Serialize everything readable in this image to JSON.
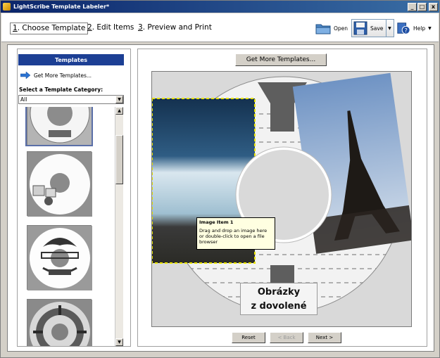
{
  "window": {
    "title": "LightScribe Template Labeler*",
    "min": "_",
    "max": "□",
    "close": "x"
  },
  "steps": [
    {
      "num": "1",
      "label": ". Choose Template"
    },
    {
      "num": "2",
      "label": ". Edit Items"
    },
    {
      "num": "3",
      "label": ". Preview and Print"
    }
  ],
  "toolbar": {
    "open": "Open",
    "save": "Save",
    "help": "Help"
  },
  "left": {
    "header": "Templates",
    "get_more": "Get More Templates...",
    "category_label": "Select a Template Category:",
    "category_value": "All"
  },
  "right": {
    "get_more_button": "Get More Templates...",
    "tooltip_title": "Image Item 1",
    "tooltip_text": "Drag and drop an image here or double-click to open a file browser",
    "caption_line1": "Obrázky",
    "caption_line2": "z dovolené",
    "reset": "Reset",
    "back": "< Back",
    "next": "Next >"
  },
  "colors": {
    "title_bar": "#0a246a",
    "panel_header": "#1c3f94",
    "tooltip_bg": "#ffffe1",
    "selection": "#ffff00"
  }
}
